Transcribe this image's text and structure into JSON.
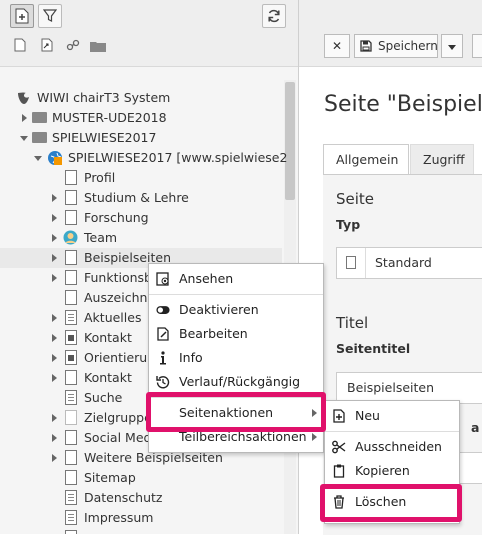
{
  "tree": {
    "root_label": "WIWI chairT3 System",
    "rows": [
      {
        "label": "MUSTER-UDE2018"
      },
      {
        "label": "SPIELWIESE2017"
      },
      {
        "label": "SPIELWIESE2017 [www.spielwiese2"
      },
      {
        "label": "Profil"
      },
      {
        "label": "Studium & Lehre"
      },
      {
        "label": "Forschung"
      },
      {
        "label": "Team"
      },
      {
        "label": "Beispielseiten"
      },
      {
        "label": "Funktionsb"
      },
      {
        "label": "Auszeichnu"
      },
      {
        "label": "Aktuelles"
      },
      {
        "label": "Kontakt"
      },
      {
        "label": "Orientierun"
      },
      {
        "label": "Kontakt"
      },
      {
        "label": "Suche"
      },
      {
        "label": "Zielgruppe"
      },
      {
        "label": "Social Med"
      },
      {
        "label": "Weitere Beispielseiten"
      },
      {
        "label": "Sitemap"
      },
      {
        "label": "Datenschutz"
      },
      {
        "label": "Impressum"
      }
    ]
  },
  "editor": {
    "close_label": "✕",
    "save_label": "Speichern",
    "page_title": "Seite \"Beispiels",
    "tabs": [
      {
        "label": "Allgemein"
      },
      {
        "label": "Zugriff"
      }
    ],
    "section_page": "Seite",
    "type_label": "Typ",
    "type_value": "Standard",
    "section_title": "Titel",
    "pagetitle_label": "Seitentitel",
    "pagetitle_value": "Beispielseiten",
    "partial_label": "a"
  },
  "context_menu": {
    "items": [
      {
        "label": "Ansehen"
      },
      {
        "label": "Deaktivieren"
      },
      {
        "label": "Bearbeiten"
      },
      {
        "label": "Info"
      },
      {
        "label": "Verlauf/Rückgängig"
      },
      {
        "label": "Seitenaktionen"
      },
      {
        "label": "Teilbereichsaktionen"
      }
    ]
  },
  "submenu": {
    "items": [
      {
        "label": "Neu"
      },
      {
        "label": "Ausschneiden"
      },
      {
        "label": "Kopieren"
      },
      {
        "label": "Löschen"
      }
    ]
  },
  "colors": {
    "highlight": "#e0116b",
    "typo3_orange": "#f49700",
    "site_blue": "#2b7fc9"
  }
}
